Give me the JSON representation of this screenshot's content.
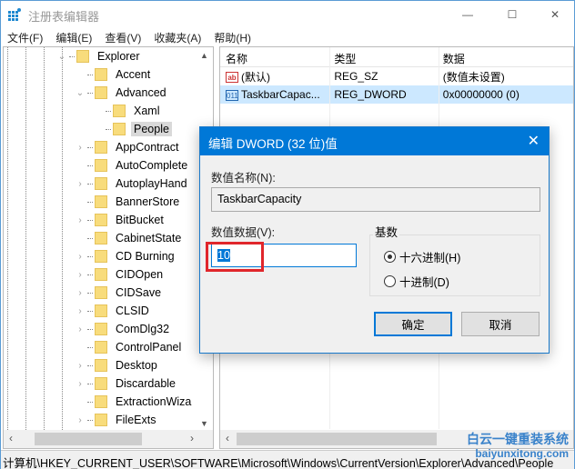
{
  "window": {
    "title": "注册表编辑器",
    "controls": {
      "minimize": "—",
      "maximize": "☐",
      "close": "✕"
    }
  },
  "menu": [
    "文件(F)",
    "编辑(E)",
    "查看(V)",
    "收藏夹(A)",
    "帮助(H)"
  ],
  "tree": {
    "nodes": [
      {
        "label": "Explorer",
        "level": 0,
        "expander": "open"
      },
      {
        "label": "Accent",
        "level": 1,
        "expander": "none"
      },
      {
        "label": "Advanced",
        "level": 1,
        "expander": "open"
      },
      {
        "label": "Xaml",
        "level": 2,
        "expander": "none"
      },
      {
        "label": "People",
        "level": 2,
        "expander": "none",
        "selected": true
      },
      {
        "label": "AppContract",
        "level": 1,
        "expander": "closed"
      },
      {
        "label": "AutoComplete",
        "level": 1,
        "expander": "none"
      },
      {
        "label": "AutoplayHand",
        "level": 1,
        "expander": "closed"
      },
      {
        "label": "BannerStore",
        "level": 1,
        "expander": "none"
      },
      {
        "label": "BitBucket",
        "level": 1,
        "expander": "closed"
      },
      {
        "label": "CabinetState",
        "level": 1,
        "expander": "none"
      },
      {
        "label": "CD Burning",
        "level": 1,
        "expander": "closed"
      },
      {
        "label": "CIDOpen",
        "level": 1,
        "expander": "closed"
      },
      {
        "label": "CIDSave",
        "level": 1,
        "expander": "closed"
      },
      {
        "label": "CLSID",
        "level": 1,
        "expander": "closed"
      },
      {
        "label": "ComDlg32",
        "level": 1,
        "expander": "closed"
      },
      {
        "label": "ControlPanel",
        "level": 1,
        "expander": "none"
      },
      {
        "label": "Desktop",
        "level": 1,
        "expander": "closed"
      },
      {
        "label": "Discardable",
        "level": 1,
        "expander": "closed"
      },
      {
        "label": "ExtractionWiza",
        "level": 1,
        "expander": "none"
      },
      {
        "label": "FileExts",
        "level": 1,
        "expander": "closed"
      }
    ]
  },
  "list": {
    "headers": [
      "名称",
      "类型",
      "数据"
    ],
    "rows": [
      {
        "icon": "ab",
        "name": "(默认)",
        "type": "REG_SZ",
        "data": "(数值未设置)"
      },
      {
        "icon": "011",
        "name": "TaskbarCapac...",
        "type": "REG_DWORD",
        "data": "0x00000000 (0)",
        "selected": true
      }
    ]
  },
  "status": {
    "path": "计算机\\HKEY_CURRENT_USER\\SOFTWARE\\Microsoft\\Windows\\CurrentVersion\\Explorer\\Advanced\\People"
  },
  "dialog": {
    "title": "编辑 DWORD (32 位)值",
    "close": "✕",
    "name_label": "数值名称(N):",
    "name_value": "TaskbarCapacity",
    "data_label": "数值数据(V):",
    "data_value": "10",
    "base_label": "基数",
    "radios": [
      {
        "label": "十六进制(H)",
        "checked": true
      },
      {
        "label": "十进制(D)",
        "checked": false
      }
    ],
    "ok": "确定",
    "cancel": "取消"
  },
  "watermark": {
    "line1": "白云一键重装系统",
    "line2": "baiyunxitong.com"
  }
}
